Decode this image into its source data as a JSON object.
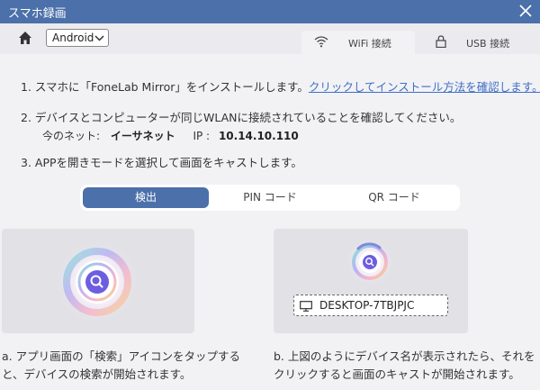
{
  "window": {
    "title": "スマホ録画"
  },
  "toolbar": {
    "platform_select": "Android",
    "tabs": [
      {
        "label": "WiFi 接続",
        "icon": "wifi-icon",
        "active": true
      },
      {
        "label": "USB 接続",
        "icon": "lock-icon",
        "active": false
      }
    ]
  },
  "steps": {
    "step1_text": "1. スマホに「FoneLab Mirror」をインストールします。",
    "step1_link": "クリックしてインストール方法を確認します。",
    "step2_text": "2. デバイスとコンピューターが同じWLANに接続されていることを確認してください。",
    "network_label": "今のネット:",
    "network_name": "イーサネット",
    "ip_label": "IP :",
    "ip_value": "10.14.10.110",
    "step3_text": "3. APPを開きモードを選択して画面をキャストします。"
  },
  "modes": [
    {
      "label": "検出",
      "active": true
    },
    {
      "label": "PIN コード",
      "active": false
    },
    {
      "label": "QR コード",
      "active": false
    }
  ],
  "panel_b": {
    "device_name": "DESKTOP-7TBJPJC"
  },
  "captions": {
    "a": "a. アプリ画面の「検索」アイコンをタップすると、デバイスの検索が開始されます。",
    "b": "b. 上図のようにデバイス名が表示されたら、それをクリックすると画面のキャストが開始されます。"
  },
  "colors": {
    "accent": "#4b70aa",
    "link": "#3f6fc4",
    "background": "#f2f2f5"
  }
}
